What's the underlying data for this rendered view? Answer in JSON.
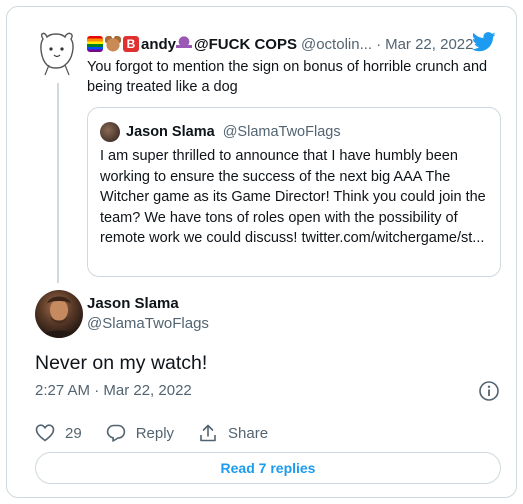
{
  "parent_tweet": {
    "name": "andy",
    "name_prefix_badge": "B",
    "name_suffix": "@FUCK COPS",
    "handle": "@octolin...",
    "separator": "·",
    "date": "Mar 22, 2022",
    "text": "You forgot to mention the sign on bonus of horrible crunch and being treated like a dog",
    "emoji_icons": [
      "rainbow-flag-icon",
      "bear-icon",
      "letter-b-icon",
      "octopus-icon"
    ]
  },
  "quoted_tweet": {
    "name": "Jason Slama",
    "handle": "@SlamaTwoFlags",
    "text": "I am super thrilled to announce that I have humbly been working to ensure the success of the next big AAA The Witcher game as its Game Director! Think you could join the team? We have tons of roles open with the possibility of remote work we could discuss! twitter.com/witchergame/st..."
  },
  "main_tweet": {
    "name": "Jason Slama",
    "handle": "@SlamaTwoFlags",
    "text": "Never on my watch!",
    "timestamp": "2:27 AM · Mar 22, 2022"
  },
  "actions": {
    "like_count": "29",
    "reply_label": "Reply",
    "share_label": "Share"
  },
  "read_replies_label": "Read 7 replies",
  "colors": {
    "accent": "#1d9bf0",
    "secondary_text": "#536471",
    "border": "#cfd9de"
  }
}
